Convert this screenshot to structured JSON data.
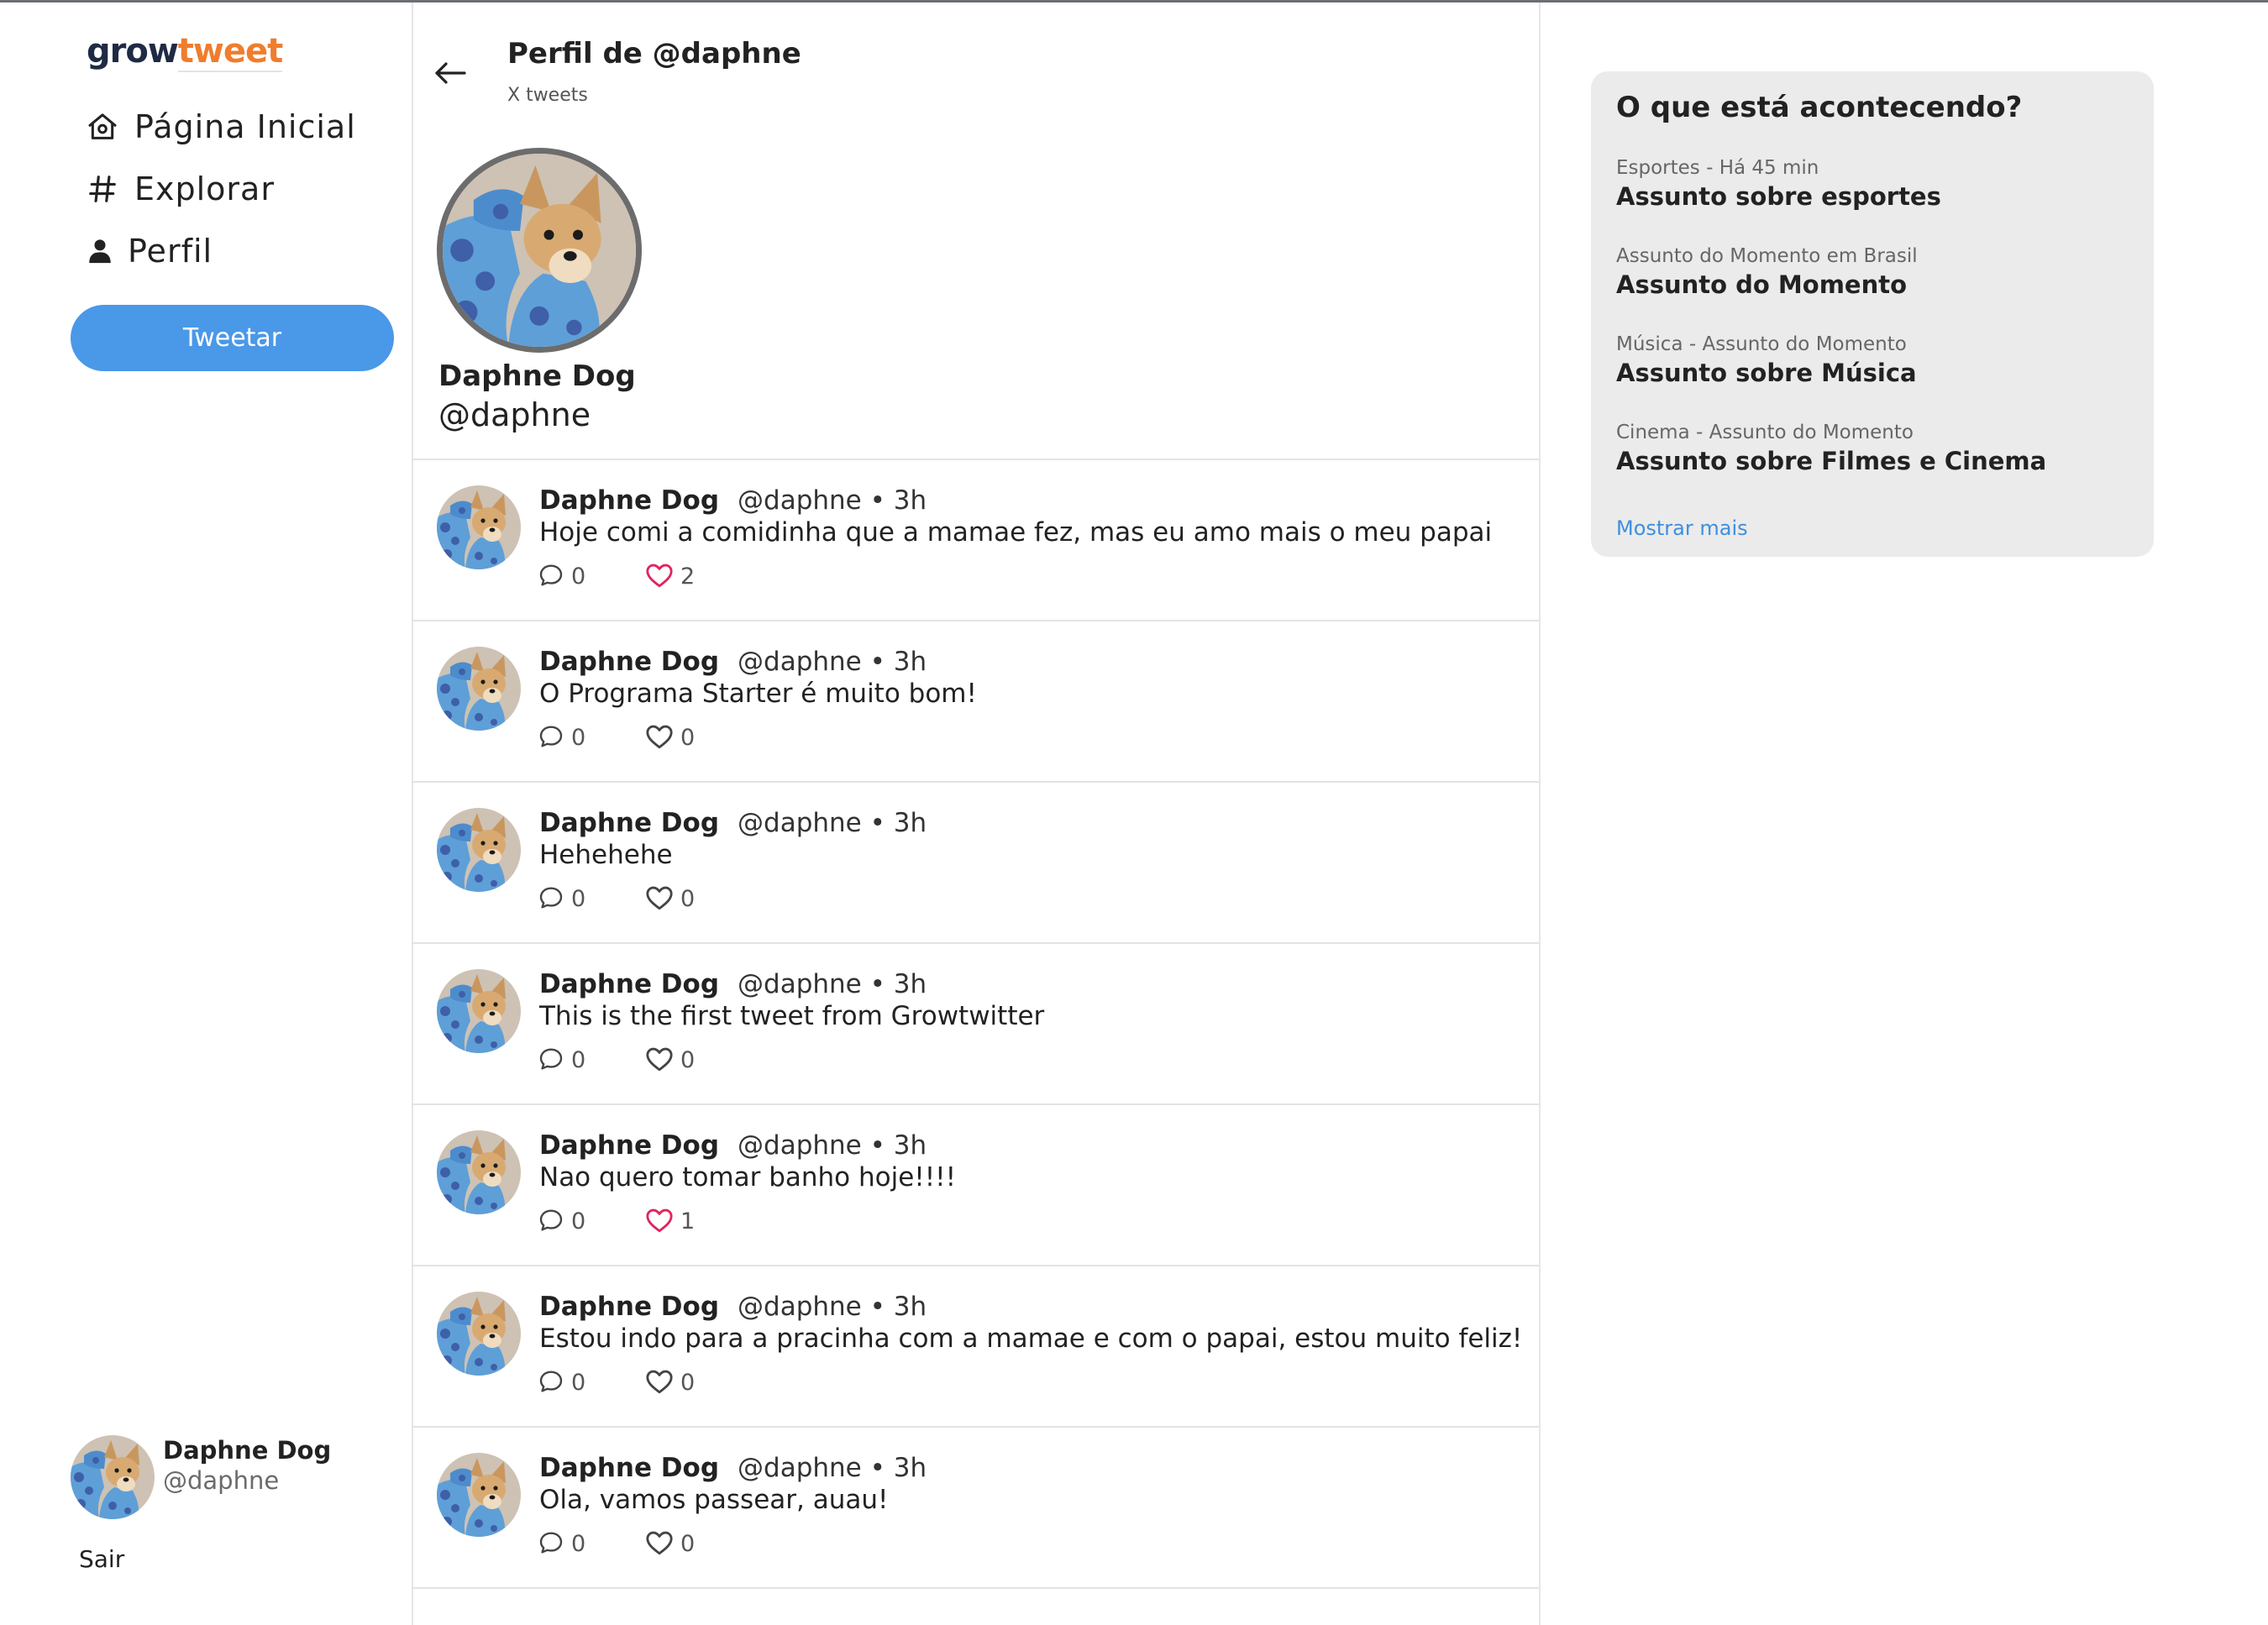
{
  "sidebar": {
    "logo": {
      "part1": "grow",
      "part2": "tweet"
    },
    "nav": [
      {
        "label": "Página Inicial",
        "icon": "home-icon"
      },
      {
        "label": "Explorar",
        "icon": "hashtag-icon"
      },
      {
        "label": "Perfil",
        "icon": "user-icon"
      }
    ],
    "tweet_button": "Tweetar",
    "current_user": {
      "name": "Daphne Dog",
      "handle": "@daphne"
    },
    "logout": "Sair"
  },
  "profile": {
    "title": "Perfil de @daphne",
    "tweet_count": "X tweets",
    "name": "Daphne Dog",
    "handle": "@daphne"
  },
  "tweets": [
    {
      "name": "Daphne Dog",
      "handle": "@daphne",
      "time": " • 3h",
      "text": "Hoje comi a comidinha que a mamae fez, mas eu amo mais o meu papai",
      "replies": "0",
      "likes": "2",
      "liked": true
    },
    {
      "name": "Daphne Dog",
      "handle": "@daphne",
      "time": " • 3h",
      "text": "O Programa Starter é muito bom!",
      "replies": "0",
      "likes": "0",
      "liked": false
    },
    {
      "name": "Daphne Dog",
      "handle": "@daphne",
      "time": " • 3h",
      "text": "Hehehehe",
      "replies": "0",
      "likes": "0",
      "liked": false
    },
    {
      "name": "Daphne Dog",
      "handle": "@daphne",
      "time": " • 3h",
      "text": "This is the first tweet from Growtwitter",
      "replies": "0",
      "likes": "0",
      "liked": false
    },
    {
      "name": "Daphne Dog",
      "handle": "@daphne",
      "time": " • 3h",
      "text": "Nao quero tomar banho hoje!!!!",
      "replies": "0",
      "likes": "1",
      "liked": true
    },
    {
      "name": "Daphne Dog",
      "handle": "@daphne",
      "time": " • 3h",
      "text": "Estou indo para a pracinha com a mamae e com o papai, estou muito feliz!",
      "replies": "0",
      "likes": "0",
      "liked": false
    },
    {
      "name": "Daphne Dog",
      "handle": "@daphne",
      "time": " • 3h",
      "text": "Ola, vamos passear, auau!",
      "replies": "0",
      "likes": "0",
      "liked": false
    }
  ],
  "trends": {
    "title": "O que está acontecendo?",
    "items": [
      {
        "category": "Esportes - Há 45 min",
        "topic": "Assunto sobre esportes"
      },
      {
        "category": "Assunto do Momento em Brasil",
        "topic": "Assunto do Momento"
      },
      {
        "category": "Música - Assunto do Momento",
        "topic": "Assunto sobre Música"
      },
      {
        "category": "Cinema - Assunto do Momento",
        "topic": "Assunto sobre Filmes e Cinema"
      }
    ],
    "show_more": "Mostrar mais"
  },
  "colors": {
    "accent": "#4a98e8",
    "logo_dark": "#1f2a44",
    "logo_orange": "#ef7d2d",
    "like_active": "#e0245e",
    "panel_bg": "#ebebeb"
  }
}
